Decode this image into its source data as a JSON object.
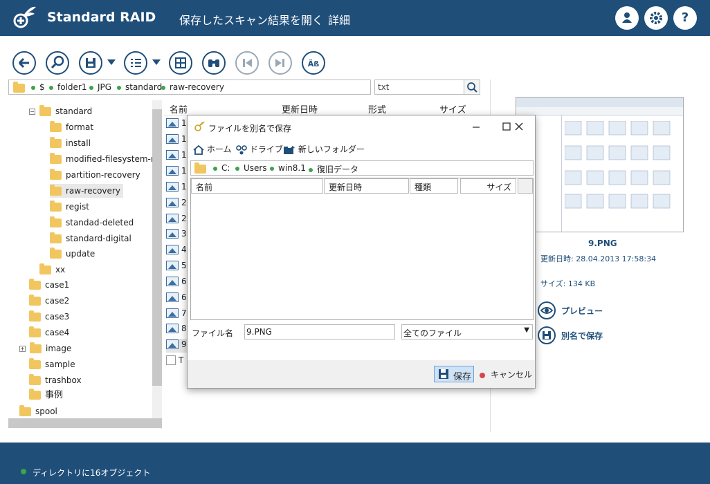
{
  "header": {
    "title": "Standard RAID",
    "menu": [
      "保存したスキャン結果を開く",
      "詳細"
    ]
  },
  "path": {
    "crumbs": [
      "$",
      "folder1",
      "JPG",
      "standard",
      "raw-recovery"
    ]
  },
  "search": {
    "value": "txt"
  },
  "tree": {
    "items": [
      {
        "label": "standard",
        "toggle": "−"
      },
      {
        "label": "format"
      },
      {
        "label": "install"
      },
      {
        "label": "modified-filesystem-recov"
      },
      {
        "label": "partition-recovery"
      },
      {
        "label": "raw-recovery"
      },
      {
        "label": "regist"
      },
      {
        "label": "standad-deleted"
      },
      {
        "label": "standard-digital"
      },
      {
        "label": "update"
      },
      {
        "label": "xx"
      },
      {
        "label": "case1"
      },
      {
        "label": "case2"
      },
      {
        "label": "case3"
      },
      {
        "label": "case4"
      },
      {
        "label": "image",
        "toggle": "+"
      },
      {
        "label": "sample"
      },
      {
        "label": "trashbox"
      },
      {
        "label": "事例"
      },
      {
        "label": "spool"
      }
    ]
  },
  "filelist": {
    "columns": [
      "名前",
      "更新日時",
      "形式",
      "サイズ"
    ],
    "rows": [
      "1",
      "1",
      "1",
      "1",
      "1",
      "2",
      "2",
      "3",
      "4",
      "5",
      "6",
      "6",
      "7",
      "8",
      "9",
      "T"
    ]
  },
  "preview": {
    "name": "9.PNG",
    "modified": "更新日時: 28.04.2013 17:58:34",
    "size": "サイズ: 134 KB",
    "preview_label": "プレビュー",
    "save_as_label": "別名で保存"
  },
  "dialog": {
    "title": "ファイルを別名で保存",
    "nav": [
      "ホーム",
      "ドライブ",
      "新しいフォルダー"
    ],
    "path": [
      "C:",
      "Users",
      "win8.1",
      "復旧データ"
    ],
    "columns": [
      "名前",
      "更新日時",
      "種類",
      "サイズ"
    ],
    "filename_label": "ファイル名",
    "filename_value": "9.PNG",
    "filetype_value": "全てのファイル",
    "save_label": "保存",
    "cancel_label": "キャンセル"
  },
  "status": {
    "text": "ディレクトリに16オブジェクト"
  },
  "colors": {
    "primary": "#1f4e79",
    "accent": "#3fa34d",
    "cancel": "#d9434b"
  }
}
